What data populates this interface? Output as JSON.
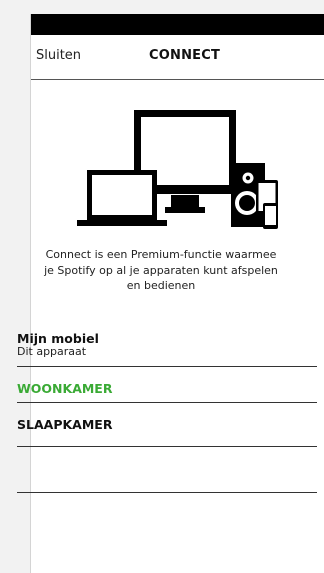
{
  "nav": {
    "close_label": "Sluiten",
    "title": "CONNECT"
  },
  "hero": {
    "icon": "connect-devices-illustration",
    "description_line1": "Connect is een Premium-functie waarmee",
    "description_line2": "je Spotify op al je apparaten kunt afspelen",
    "description_line3": "en bedienen"
  },
  "devices": {
    "mobile": {
      "name": "Mijn mobiel",
      "subtitle": "Dit apparaat"
    },
    "woonkamer": {
      "name": "WOONKAMER",
      "color": "#3aaa35"
    },
    "slaapkamer": {
      "name": "SLAAPKAMER"
    }
  },
  "colors": {
    "accent_green": "#3aaa35",
    "status_bar": "#000000",
    "page_background": "#f2f2f2"
  }
}
